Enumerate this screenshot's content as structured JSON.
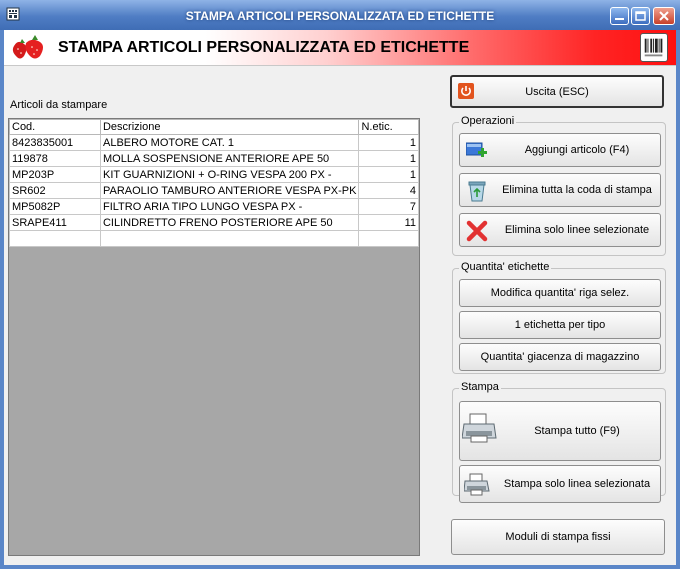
{
  "window": {
    "title": "STAMPA ARTICOLI PERSONALIZZATA ED ETICHETTE"
  },
  "banner": {
    "title": "STAMPA ARTICOLI PERSONALIZZATA ED ETICHETTE"
  },
  "list": {
    "label": "Articoli da stampare",
    "columns": [
      "Cod.",
      "Descrizione",
      "N.etic."
    ],
    "rows": [
      {
        "code": "8423835001",
        "desc": "ALBERO MOTORE CAT. 1",
        "qty": "1"
      },
      {
        "code": "119878",
        "desc": "MOLLA SOSPENSIONE ANTERIORE APE 50",
        "qty": "1"
      },
      {
        "code": "MP203P",
        "desc": "KIT GUARNIZIONI + O-RING VESPA 200 PX -",
        "qty": "1"
      },
      {
        "code": "SR602",
        "desc": "PARAOLIO TAMBURO ANTERIORE VESPA PX-PK",
        "qty": "4"
      },
      {
        "code": "MP5082P",
        "desc": "FILTRO ARIA TIPO LUNGO VESPA PX -",
        "qty": "7"
      },
      {
        "code": "SRAPE411",
        "desc": "CILINDRETTO FRENO POSTERIORE APE 50",
        "qty": "11"
      },
      {
        "code": "",
        "desc": "",
        "qty": ""
      }
    ]
  },
  "actions": {
    "exit": "Uscita (ESC)",
    "operations": {
      "title": "Operazioni",
      "add": "Aggiungi articolo (F4)",
      "clear_queue": "Elimina tutta la coda di stampa",
      "delete_selected": "Elimina solo linee selezionate"
    },
    "quantity": {
      "title": "Quantita' etichette",
      "edit_row": "Modifica quantita' riga selez.",
      "one_per_type": "1 etichetta per tipo",
      "stock_qty": "Quantita' giacenza di magazzino"
    },
    "print": {
      "title": "Stampa",
      "print_all": "Stampa tutto (F9)",
      "print_selected": "Stampa solo linea selezionata"
    },
    "fixed_modules": "Moduli di stampa fissi"
  },
  "colors": {
    "title_bar": "#4f7dc4",
    "banner_red": "#ff2424",
    "grid_bg": "#a7a7a7"
  }
}
